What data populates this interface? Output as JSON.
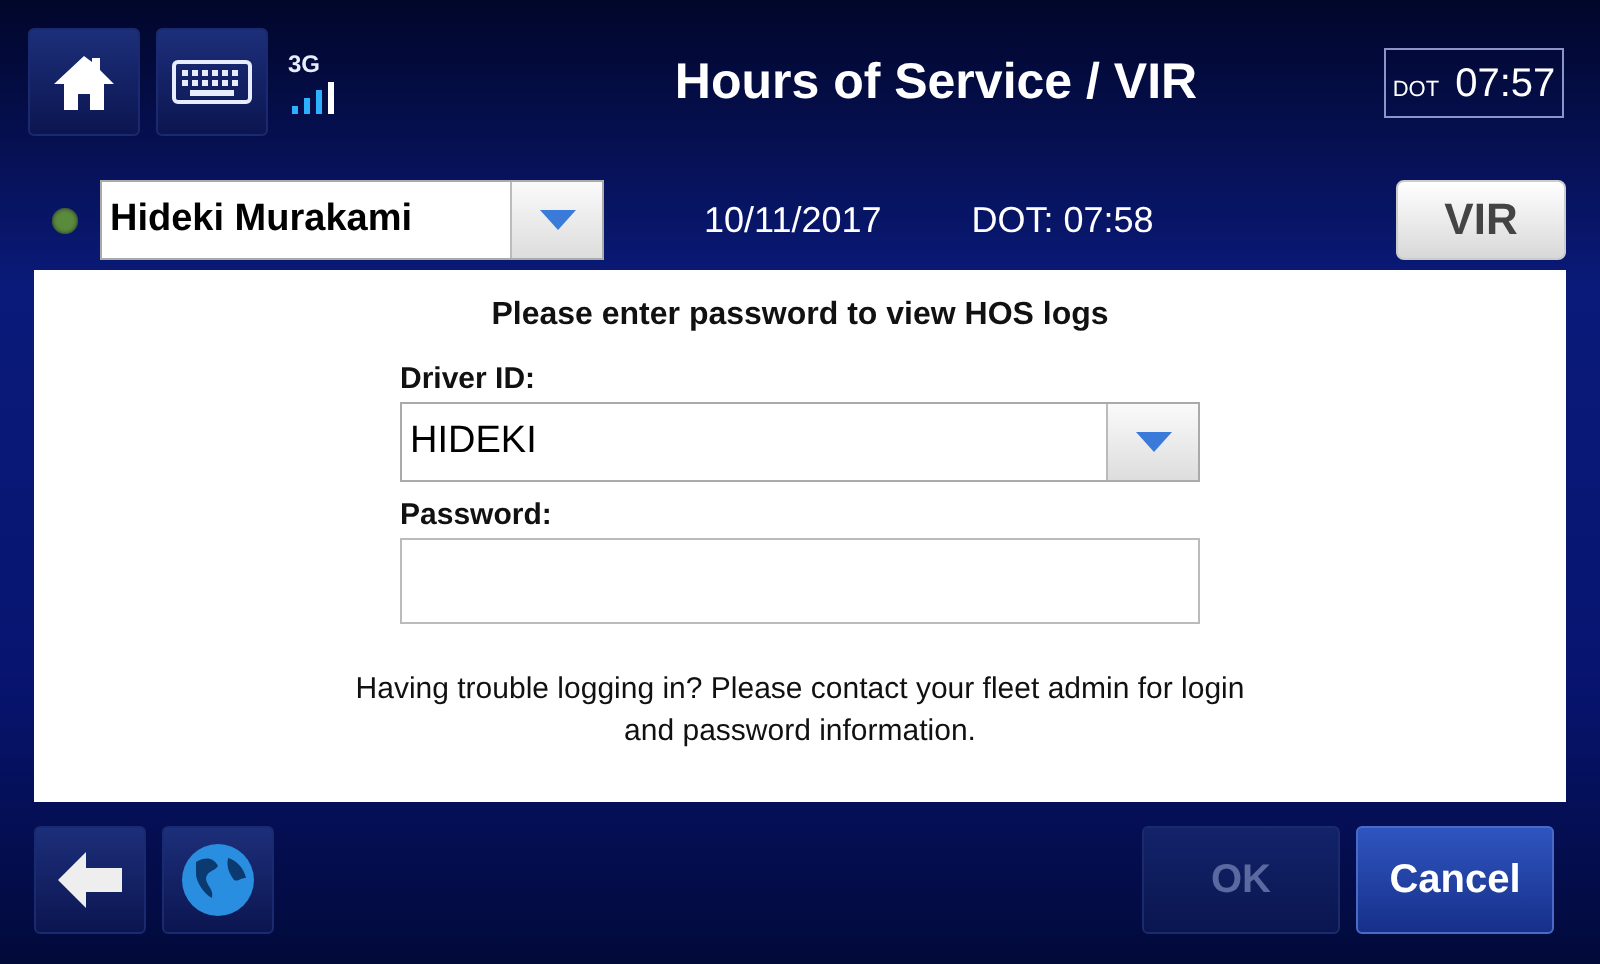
{
  "header": {
    "title": "Hours of Service / VIR",
    "network": "3G",
    "clock": {
      "label": "DOT",
      "time": "07:57"
    }
  },
  "driver_bar": {
    "driver": {
      "name": "Hideki Murakami",
      "color": "#5a8a3c"
    },
    "date": "10/11/2017",
    "dot_time": "DOT: 07:58",
    "vir_button": "VIR"
  },
  "login": {
    "prompt": "Please enter password to view HOS logs",
    "fields": [
      {
        "kind": "select",
        "label": "Driver ID:",
        "value": "HIDEKI"
      },
      {
        "kind": "password",
        "label": "Password:"
      }
    ],
    "help": "Having trouble logging in? Please contact your fleet admin for login and password information."
  },
  "footer": {
    "buttons": [
      {
        "label": "OK",
        "disabled": true
      },
      {
        "label": "Cancel",
        "disabled": false
      }
    ]
  }
}
